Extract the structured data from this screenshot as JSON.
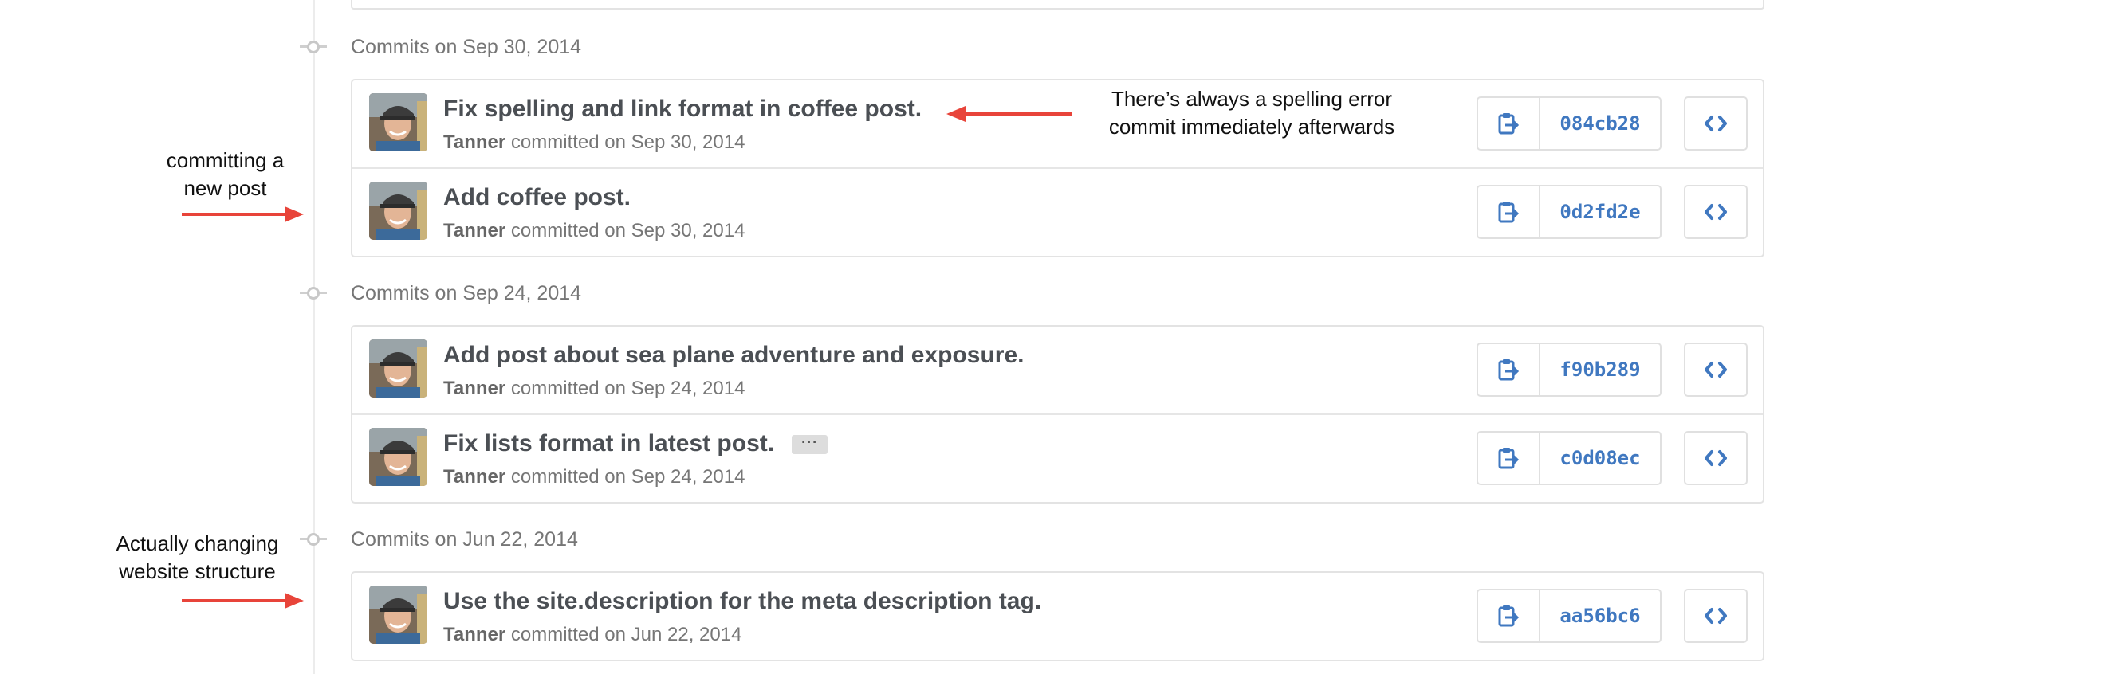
{
  "groups": [
    {
      "date_label": "Commits on Sep 30, 2014",
      "commits": [
        {
          "message": "Fix spelling and link format in coffee post.",
          "author": "Tanner",
          "meta": "committed on Sep 30, 2014",
          "sha": "084cb28",
          "has_ellipsis": false
        },
        {
          "message": "Add coffee post.",
          "author": "Tanner",
          "meta": "committed on Sep 30, 2014",
          "sha": "0d2fd2e",
          "has_ellipsis": false
        }
      ]
    },
    {
      "date_label": "Commits on Sep 24, 2014",
      "commits": [
        {
          "message": "Add post about sea plane adventure and exposure.",
          "author": "Tanner",
          "meta": "committed on Sep 24, 2014",
          "sha": "f90b289",
          "has_ellipsis": false
        },
        {
          "message": "Fix lists format in latest post.",
          "author": "Tanner",
          "meta": "committed on Sep 24, 2014",
          "sha": "c0d08ec",
          "has_ellipsis": true
        }
      ]
    },
    {
      "date_label": "Commits on Jun 22, 2014",
      "commits": [
        {
          "message": "Use the site.description for the meta description tag.",
          "author": "Tanner",
          "meta": "committed on Jun 22, 2014",
          "sha": "aa56bc6",
          "has_ellipsis": false
        }
      ]
    }
  ],
  "ellipsis_label": "···",
  "annotations": {
    "spelling": {
      "line1": "There’s always a spelling error",
      "line2": "commit immediately afterwards"
    },
    "new_post": {
      "line1": "committing a",
      "line2": "new post"
    },
    "structure": {
      "line1": "Actually changing",
      "line2": "website structure"
    }
  },
  "icons": {
    "copy": "clipboard-icon",
    "browse": "code-icon",
    "node": "commit-node-icon"
  },
  "colors": {
    "sha_link": "#4078c0",
    "annotation_arrow": "#e8443a",
    "border": "#e3e3e3"
  }
}
